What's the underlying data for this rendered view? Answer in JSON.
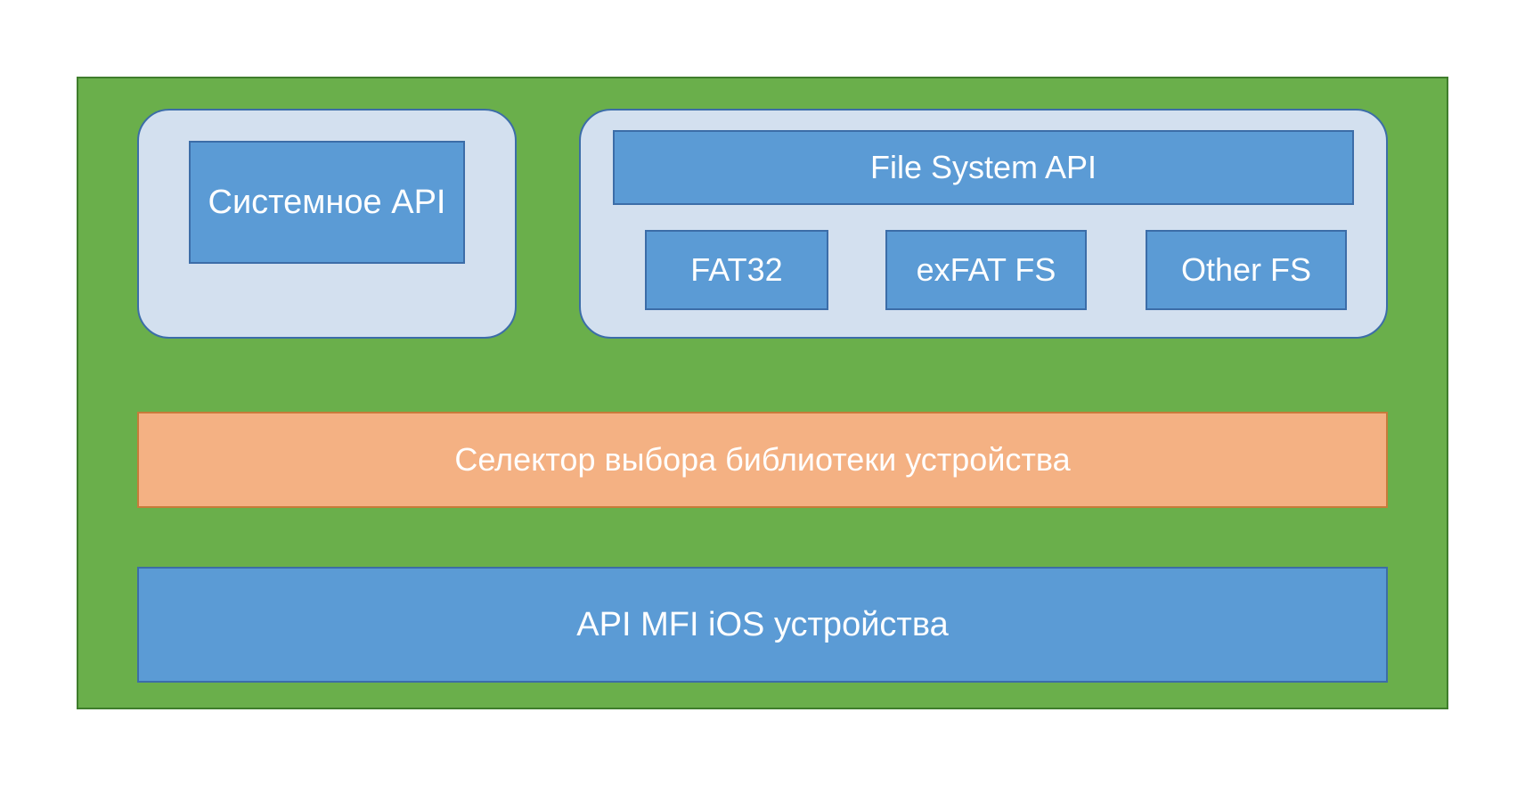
{
  "colors": {
    "green_bg": "#6AAF4B",
    "green_border": "#3F7D2C",
    "panel_bg": "#D3E0EF",
    "panel_border": "#3C6DA8",
    "blue_bg": "#5B9BD5",
    "blue_border": "#3C6DA8",
    "orange_bg": "#F4B183",
    "orange_border": "#C77B3A",
    "text": "#FFFFFF"
  },
  "top_left": {
    "system_api": "Системное API"
  },
  "top_right": {
    "file_system_api": "File System API",
    "fs": {
      "fat32": "FAT32",
      "exfat": "exFAT FS",
      "other": "Other FS"
    }
  },
  "middle": {
    "selector": "Селектор выбора библиотеки устройства"
  },
  "bottom": {
    "mfi_api": "API MFI iOS устройства"
  }
}
